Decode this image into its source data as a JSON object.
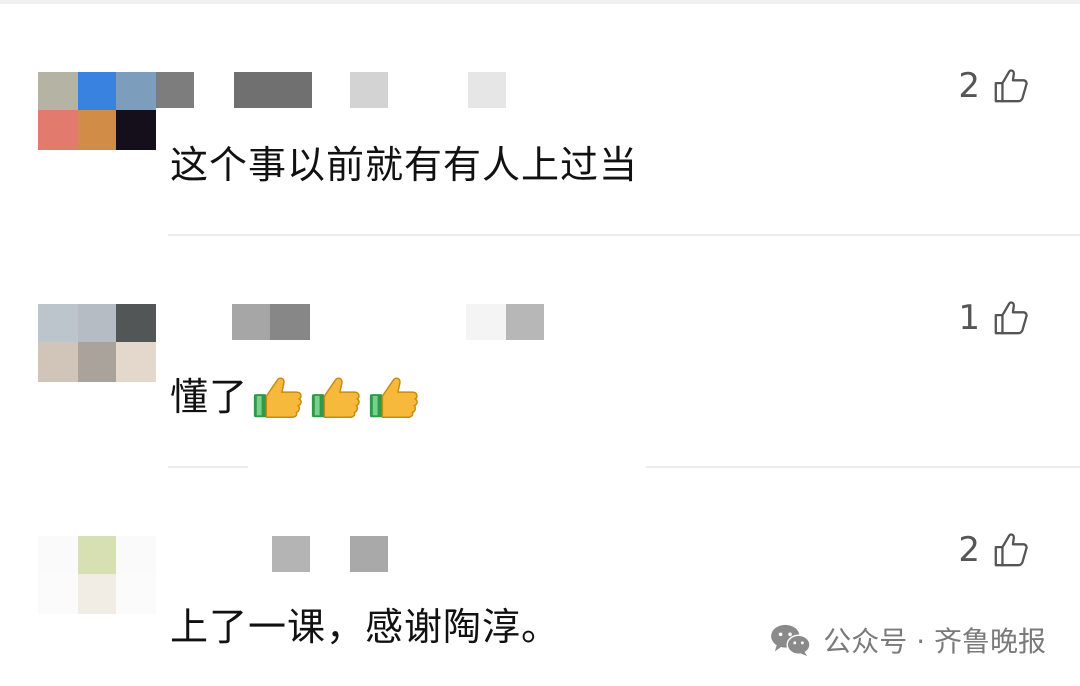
{
  "comments": [
    {
      "text": "这个事以前就有有人上过当",
      "likes": "2"
    },
    {
      "text": "懂了",
      "emoji": [
        "👍",
        "👍",
        "👍"
      ],
      "likes": "1"
    },
    {
      "text": "上了一课，感谢陶淳。",
      "likes": "2"
    }
  ],
  "footer": {
    "source": "公众号 · 齐鲁晚报"
  },
  "icons": {
    "like": "thumbs-up-outline-icon",
    "emoji": "thumbs-up-emoji-icon",
    "footer": "wechat-icon"
  },
  "colors": {
    "text": "#111111",
    "count": "#555555",
    "divider": "#ececec",
    "footer": "#7a7a7a"
  }
}
